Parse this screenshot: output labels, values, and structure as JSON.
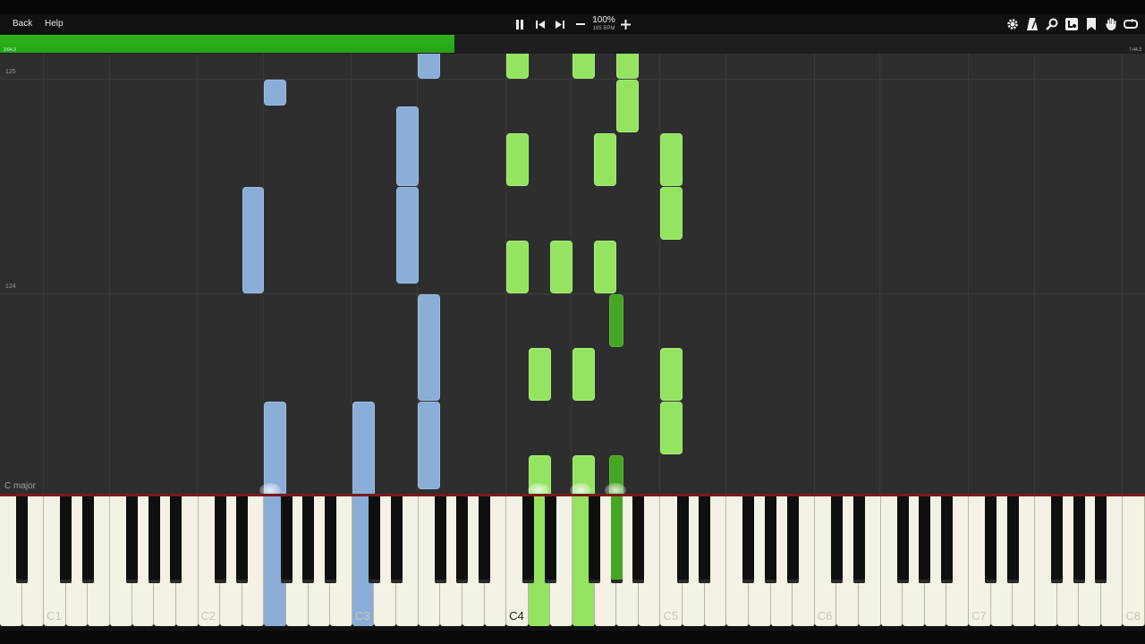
{
  "menu": {
    "back": "Back",
    "help": "Help"
  },
  "transport": {
    "zoom": "100%",
    "bpm": "165 BPM"
  },
  "progress": {
    "fraction": 0.397,
    "elapsed": "3:04.3",
    "total": "7:44.3"
  },
  "measures": [
    "125",
    "124"
  ],
  "key_signature": "C major",
  "key_labels": [
    "C1",
    "C2",
    "C3",
    "C4",
    "C5",
    "C6",
    "C7",
    "C8"
  ],
  "colors": {
    "left_hand": "#8aaed8",
    "right_hand": "#94e462",
    "right_hand_dark": "#46a626",
    "progress": "#2fb41d"
  },
  "toolbar_icons": [
    "gear-icon",
    "metronome-icon",
    "search-icon",
    "labels-icon",
    "bookmark-icon",
    "hand-icon",
    "loop-icon"
  ]
}
